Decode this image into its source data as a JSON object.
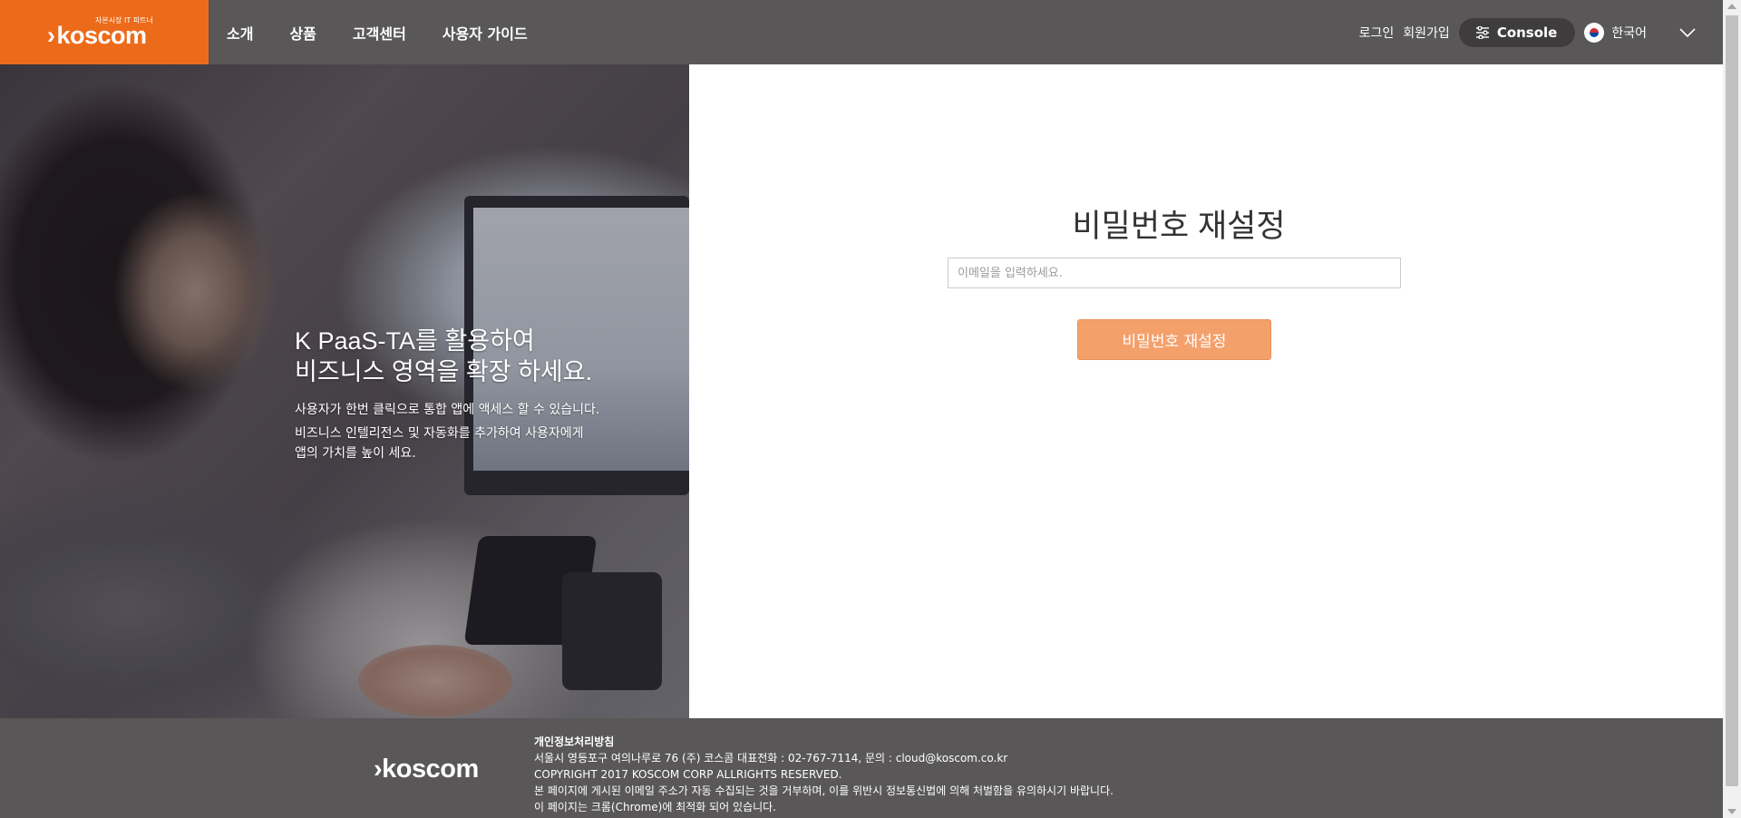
{
  "header": {
    "logo": {
      "tagline": "자본시장 IT 파트너",
      "name": "koscom",
      "chevron": "›"
    },
    "nav": [
      {
        "label": "소개"
      },
      {
        "label": "상품"
      },
      {
        "label": "고객센터"
      },
      {
        "label": "사용자 가이드"
      }
    ],
    "login_label": "로그인",
    "signup_label": "회원가입",
    "console_label": "Console",
    "language_label": "한국어"
  },
  "hero": {
    "title_line1": "K PaaS-TA를 활용하여",
    "title_line2": "비즈니스 영역을 확장 하세요.",
    "desc_line1": "사용자가 한번 클릭으로 통합 앱에 액세스 할 수 있습니다.",
    "desc_line2": "비즈니스 인텔리전스 및 자동화를 추가하여 사용자에게",
    "desc_line3": "앱의 가치를 높이 세요."
  },
  "form": {
    "title": "비밀번호 재설정",
    "email_placeholder": "이메일을 입력하세요.",
    "submit_label": "비밀번호 재설정"
  },
  "footer": {
    "logo": "koscom",
    "chevron": "›",
    "privacy_label": "개인정보처리방침",
    "address": "서울시 영등포구 여의나루로 76 (주) 코스콤 대표전화 : 02-767-7114, 문의 : cloud@koscom.co.kr",
    "copyright": "COPYRIGHT 2017 KOSCOM CORP ALLRIGHTS RESERVED.",
    "notice": "본 페이지에 게시된 이메일 주소가 자동 수집되는 것을 거부하며, 이를 위반시 정보통신법에 의해 처벌함을 유의하시기 바랍니다.",
    "browser_note": "이 페이지는 크롬(Chrome)에 최적화 되어 있습니다."
  },
  "colors": {
    "brand_orange": "#ec6b1b",
    "header_gray": "#595757",
    "button_orange": "#f4a06b"
  },
  "icons": [
    "settings-sliders-icon",
    "korea-flag-icon",
    "chevron-down-icon"
  ]
}
